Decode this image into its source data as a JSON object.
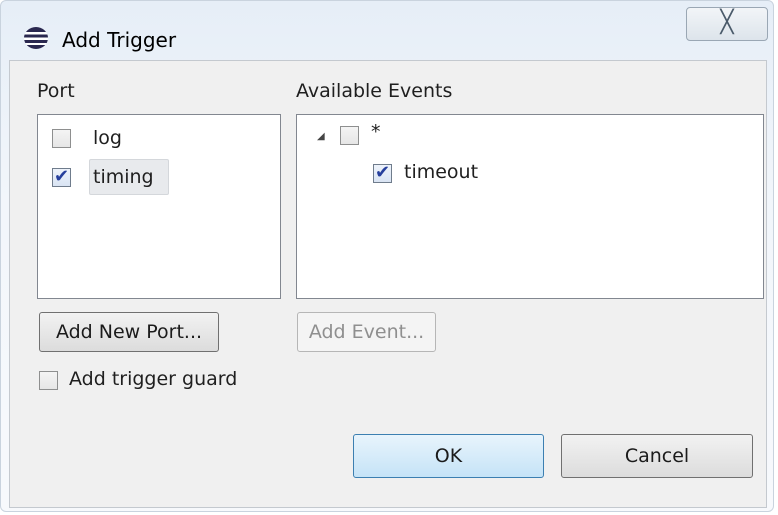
{
  "window": {
    "title": "Add Trigger",
    "close_glyph": "╳"
  },
  "port_panel": {
    "label": "Port",
    "items": [
      {
        "label": "log",
        "checked": false
      },
      {
        "label": "timing",
        "checked": true
      }
    ],
    "add_button": "Add New Port..."
  },
  "events_panel": {
    "label": "Available Events",
    "tree": {
      "root": {
        "label": "*",
        "checked": false,
        "expanded": true
      },
      "children": [
        {
          "label": "timeout",
          "checked": true
        }
      ]
    },
    "add_button": "Add Event..."
  },
  "trigger_guard": {
    "label": "Add trigger guard",
    "checked": false
  },
  "buttons": {
    "ok": "OK",
    "cancel": "Cancel"
  },
  "icons": {
    "checkmark": "✔",
    "expand": "◢"
  }
}
